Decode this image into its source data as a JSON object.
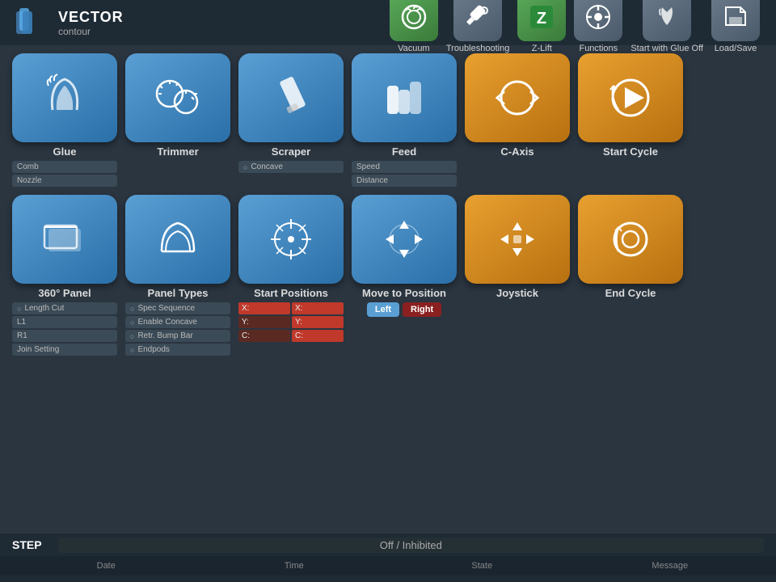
{
  "logo": {
    "vector": "VECTOR",
    "contour": "contour"
  },
  "top_nav": [
    {
      "id": "vacuum",
      "label": "Vacuum",
      "icon": "〜",
      "color": "green"
    },
    {
      "id": "troubleshooting",
      "label": "Troubleshooting",
      "icon": "🔧",
      "color": "gray"
    },
    {
      "id": "zlift",
      "label": "Z-Lift",
      "icon": "Z",
      "color": "green"
    },
    {
      "id": "functions",
      "label": "Functions",
      "icon": "⚙",
      "color": "gray"
    },
    {
      "id": "start_glue_off",
      "label": "Start with Glue Off",
      "icon": "〜",
      "color": "gray"
    },
    {
      "id": "load_save",
      "label": "Load/Save",
      "icon": "📁",
      "color": "gray"
    }
  ],
  "row1": [
    {
      "id": "glue",
      "label": "Glue",
      "icon": "glue",
      "color": "blue",
      "subopts": [
        {
          "label": "Comb",
          "radio": false
        },
        {
          "label": "Nozzle",
          "radio": false
        }
      ]
    },
    {
      "id": "trimmer",
      "label": "Trimmer",
      "icon": "trimmer",
      "color": "blue",
      "subopts": []
    },
    {
      "id": "scraper",
      "label": "Scraper",
      "icon": "scraper",
      "color": "blue",
      "subopts": [
        {
          "label": "Concave",
          "radio": true
        }
      ]
    },
    {
      "id": "feed",
      "label": "Feed",
      "icon": "feed",
      "color": "blue",
      "subopts": [
        {
          "label": "Speed",
          "radio": false
        },
        {
          "label": "Distance",
          "radio": false
        }
      ]
    },
    {
      "id": "caxis",
      "label": "C-Axis",
      "icon": "caxis",
      "color": "orange",
      "subopts": []
    },
    {
      "id": "start_cycle",
      "label": "Start Cycle",
      "icon": "start_cycle",
      "color": "orange",
      "subopts": []
    }
  ],
  "row2": [
    {
      "id": "panel360",
      "label": "360° Panel",
      "icon": "panel360",
      "color": "blue",
      "subopts": [
        {
          "label": "Length Cut",
          "radio": true
        },
        {
          "label": "L1",
          "radio": false
        },
        {
          "label": "R1",
          "radio": false
        },
        {
          "label": "Join Setting",
          "radio": false
        }
      ]
    },
    {
      "id": "panel_types",
      "label": "Panel Types",
      "icon": "panel_types",
      "color": "blue",
      "subopts": [
        {
          "label": "Spec Sequence",
          "radio": true
        },
        {
          "label": "Enable Concave",
          "radio": true
        },
        {
          "label": "Retr. Bump Bar",
          "radio": true
        },
        {
          "label": "Endpods",
          "radio": true
        }
      ]
    },
    {
      "id": "start_positions",
      "label": "Start Positions",
      "icon": "start_positions",
      "color": "blue",
      "subopts": "start_pos"
    },
    {
      "id": "move_position",
      "label": "Move to Position",
      "icon": "move_position",
      "color": "blue",
      "subopts": "move_pos"
    },
    {
      "id": "joystick",
      "label": "Joystick",
      "icon": "joystick",
      "color": "orange",
      "subopts": []
    },
    {
      "id": "end_cycle",
      "label": "End Cycle",
      "icon": "end_cycle",
      "color": "orange",
      "subopts": []
    }
  ],
  "start_pos_cells": [
    {
      "label": "X:",
      "dark": false
    },
    {
      "label": "X:",
      "dark": false
    },
    {
      "label": "Y:",
      "dark": true
    },
    {
      "label": "Y:",
      "dark": false
    },
    {
      "label": "C:",
      "dark": true
    },
    {
      "label": "C:",
      "dark": false
    }
  ],
  "move_pos_btns": [
    {
      "label": "Left",
      "active": true
    },
    {
      "label": "Right",
      "active": false
    }
  ],
  "bottom": {
    "step_label": "STEP",
    "status": "Off / Inhibited",
    "footer_items": [
      "Date",
      "Time",
      "State",
      "Message"
    ]
  }
}
